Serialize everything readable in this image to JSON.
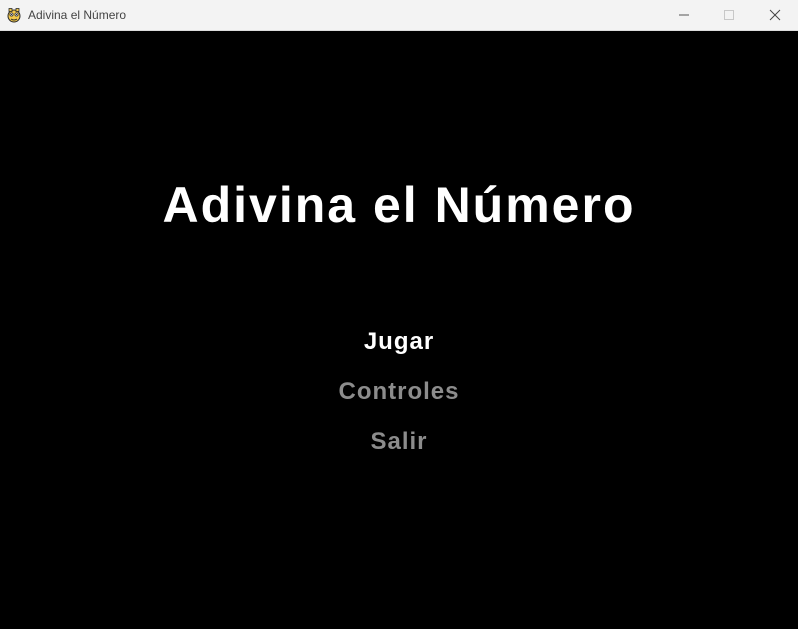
{
  "window": {
    "title": "Adivina el Número",
    "app_icon": "pygame-snake-icon",
    "controls": {
      "minimize_icon": "minimize-icon",
      "maximize_icon": "maximize-icon",
      "close_icon": "close-icon"
    }
  },
  "game": {
    "title": "Adivina el Número",
    "menu": {
      "items": [
        {
          "label": "Jugar",
          "selected": true
        },
        {
          "label": "Controles",
          "selected": false
        },
        {
          "label": "Salir",
          "selected": false
        }
      ]
    },
    "colors": {
      "background": "#000000",
      "title": "#ffffff",
      "selected_item": "#ffffff",
      "unselected_item": "#8c8c8c"
    }
  }
}
